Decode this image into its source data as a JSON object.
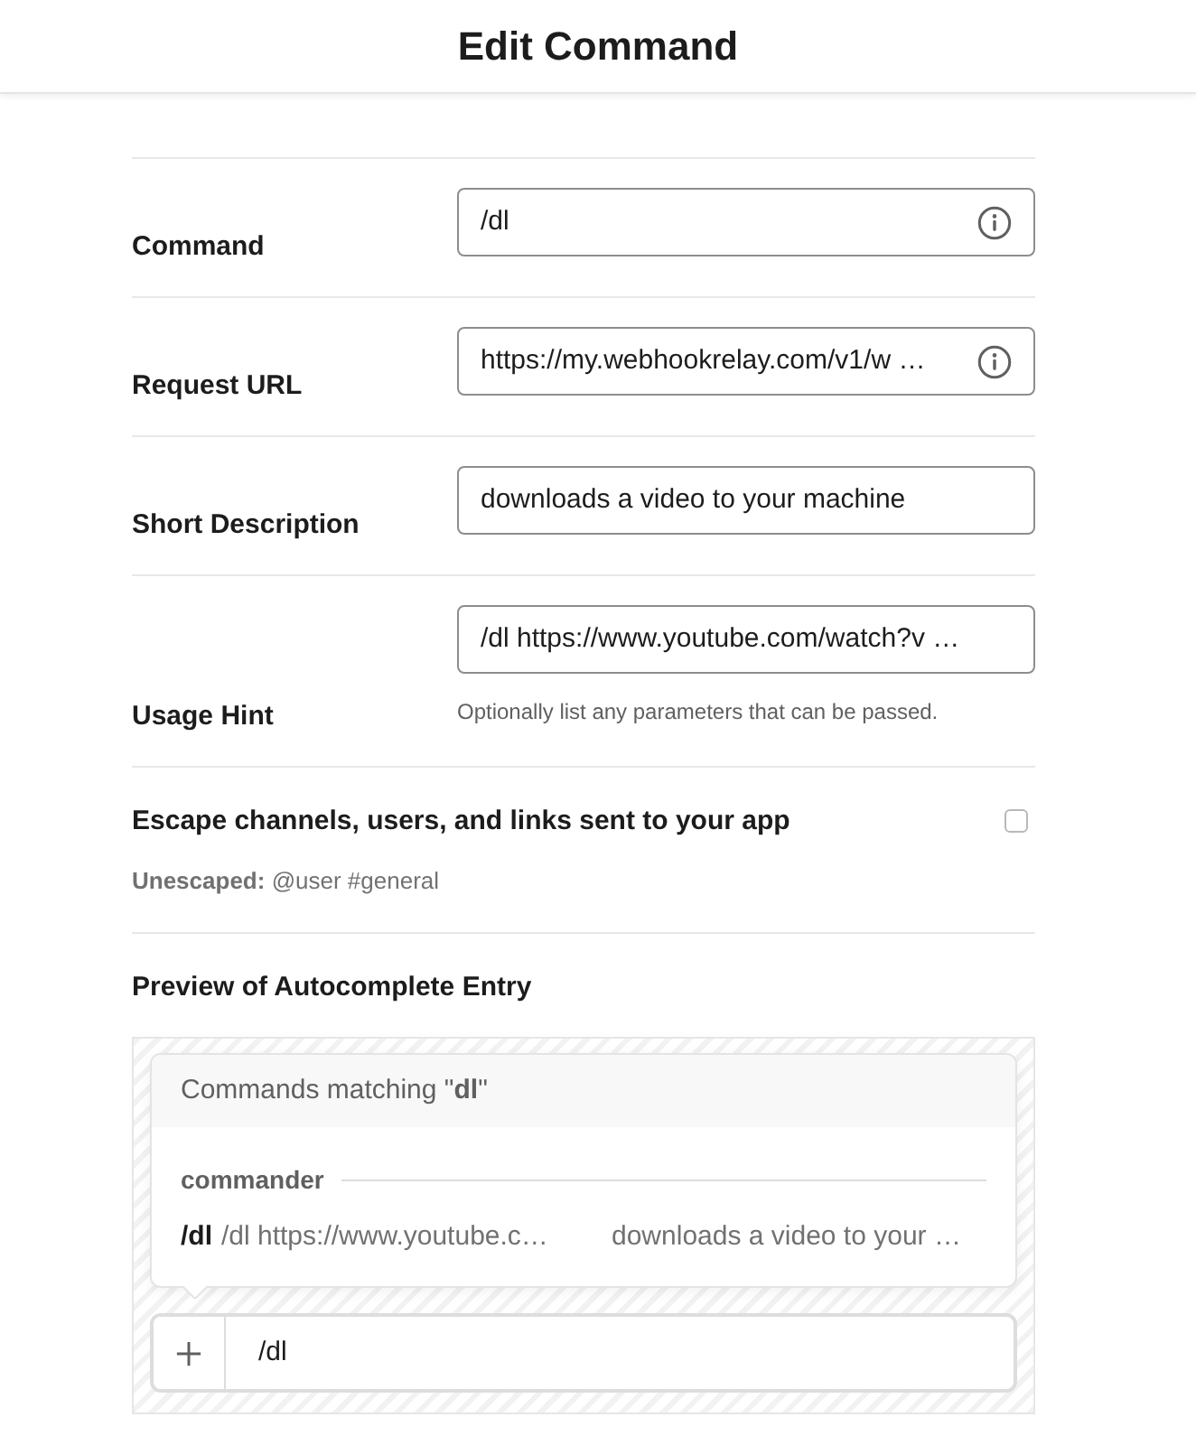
{
  "header": {
    "title": "Edit Command"
  },
  "fields": [
    {
      "label": "Command",
      "value": "/dl",
      "has_info": true
    },
    {
      "label": "Request URL",
      "value": "https://my.webhookrelay.com/v1/w …",
      "has_info": true
    },
    {
      "label": "Short Description",
      "value": "downloads a video to your machine",
      "has_info": false
    },
    {
      "label": "Usage Hint",
      "value": "/dl https://www.youtube.com/watch?v …",
      "has_info": false,
      "help": "Optionally list any parameters that can be passed."
    }
  ],
  "escape": {
    "label": "Escape channels, users, and links sent to your app",
    "checked": false,
    "example": "**Unescaped:** @user #general"
  },
  "preview": {
    "heading": "Preview of Autocomplete Entry",
    "popup": {
      "header": "Commands matching \"**dl**\"",
      "group": "commander",
      "items": [
        {
          "command": "/dl",
          "usage": "/dl https://www.youtube.c…",
          "description": "downloads a video to your …",
          "selected": false
        }
      ]
    },
    "composer": {
      "value": "/dl"
    }
  }
}
